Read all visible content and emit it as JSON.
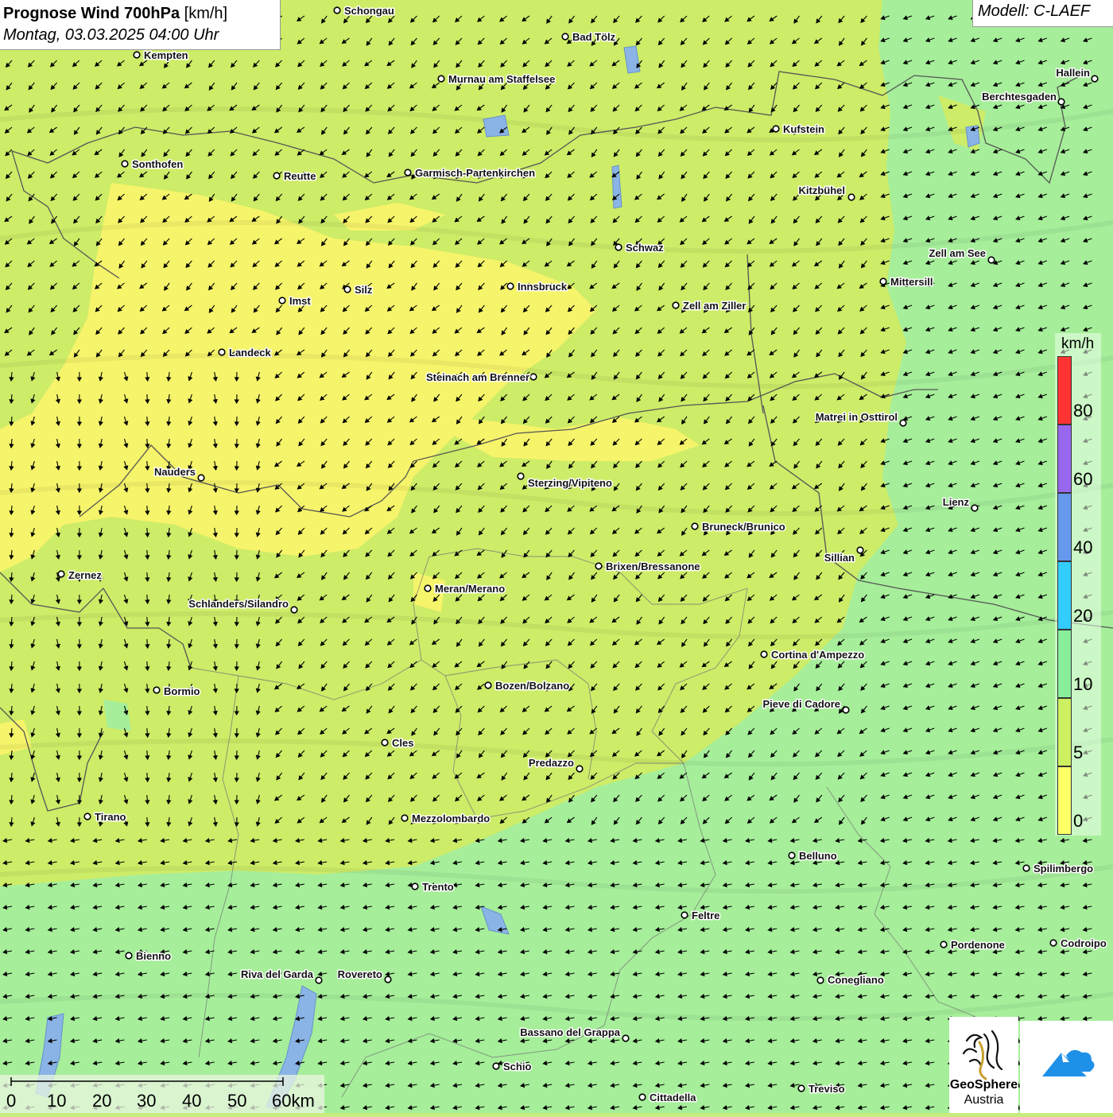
{
  "header": {
    "title_main": "Prognose Wind 700hPa",
    "title_unit": "[km/h]",
    "datetime": "Montag, 03.03.2025 04:00 Uhr",
    "model": "Modell: C-LAEF"
  },
  "legend": {
    "unit": "km/h",
    "classes": [
      {
        "label": "80",
        "color": "#ff3333"
      },
      {
        "label": "60",
        "color": "#9966ee"
      },
      {
        "label": "40",
        "color": "#6699ee"
      },
      {
        "label": "20",
        "color": "#33ccff"
      },
      {
        "label": "10",
        "color": "#88ee99"
      },
      {
        "label": "5",
        "color": "#ccf060"
      },
      {
        "label": "0",
        "color": "#ffff66"
      }
    ]
  },
  "scale": {
    "labels": [
      "0",
      "10",
      "20",
      "30",
      "40",
      "50",
      "60km"
    ]
  },
  "logos": {
    "geosphere_line1": "GeoSphere",
    "geosphere_line2": "Austria"
  },
  "colors": {
    "calm_yellow": "#f6f46a",
    "low_green": "#cdec68",
    "mid_green": "#a6ee9a",
    "border": "#555555",
    "lake": "#8bb4e6",
    "arrow": "#000000"
  },
  "cities": [
    {
      "name": "Schongau"
    },
    {
      "name": "Bad Tölz"
    },
    {
      "name": "Kempten"
    },
    {
      "name": "Murnau am Staffelsee"
    },
    {
      "name": "Hallein"
    },
    {
      "name": "Berchtesgaden"
    },
    {
      "name": "Kufstein"
    },
    {
      "name": "Sonthofen"
    },
    {
      "name": "Reutte"
    },
    {
      "name": "Garmisch-Partenkirchen"
    },
    {
      "name": "Kitzbühel"
    },
    {
      "name": "Schwaz"
    },
    {
      "name": "Zell am See"
    },
    {
      "name": "Mittersill"
    },
    {
      "name": "Silz"
    },
    {
      "name": "Innsbruck"
    },
    {
      "name": "Imst"
    },
    {
      "name": "Zell am Ziller"
    },
    {
      "name": "Landeck"
    },
    {
      "name": "Steinach am Brenner"
    },
    {
      "name": "Matrei in Osttirol"
    },
    {
      "name": "Nauders"
    },
    {
      "name": "Sterzing/Vipiteno"
    },
    {
      "name": "Lienz"
    },
    {
      "name": "Bruneck/Brunico"
    },
    {
      "name": "Sillian"
    },
    {
      "name": "Brixen/Bressanone"
    },
    {
      "name": "Zernez"
    },
    {
      "name": "Meran/Merano"
    },
    {
      "name": "Schlanders/Silandro"
    },
    {
      "name": "Cortina d'Ampezzo"
    },
    {
      "name": "Bozen/Bolzano"
    },
    {
      "name": "Bormio"
    },
    {
      "name": "Pieve di Cadore"
    },
    {
      "name": "Cles"
    },
    {
      "name": "Predazzo"
    },
    {
      "name": "Tirano"
    },
    {
      "name": "Mezzolombardo"
    },
    {
      "name": "Belluno"
    },
    {
      "name": "Spilimbergo"
    },
    {
      "name": "Trento"
    },
    {
      "name": "Feltre"
    },
    {
      "name": "Pordenone"
    },
    {
      "name": "Codroipo"
    },
    {
      "name": "Bienno"
    },
    {
      "name": "Riva del Garda"
    },
    {
      "name": "Rovereto"
    },
    {
      "name": "Conegliano"
    },
    {
      "name": "Bassano del Grappa"
    },
    {
      "name": "Schio"
    },
    {
      "name": "Treviso"
    },
    {
      "name": "Cittadella"
    }
  ]
}
